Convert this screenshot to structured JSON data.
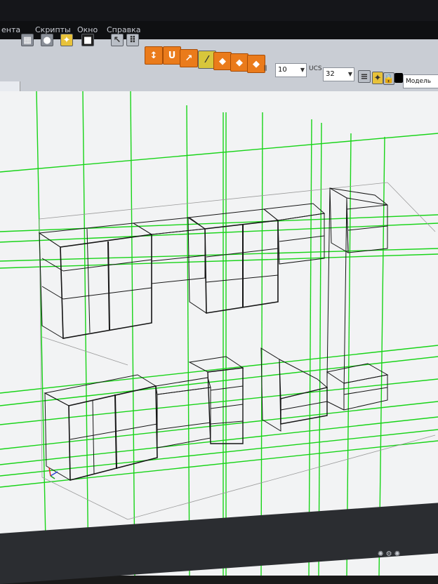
{
  "menubar": {
    "items": [
      "ента",
      "Скрипты",
      "Окно",
      "Справка"
    ]
  },
  "toolbar": {
    "layers_label": "10",
    "ucs_label": "UCS",
    "ucs_value": "32",
    "view_mode": "Модель"
  },
  "colors": {
    "guide_green": "#18d418",
    "frame_black": "#151515",
    "toolbar_bg": "#c9cdd4",
    "viewport_bg": "#f2f3f4"
  },
  "icons": {
    "toolbar_tools": [
      "cursor-icon",
      "dotted-grid-icon",
      "magnet-icon",
      "snap-icon",
      "measure-icon",
      "view-front-icon",
      "view-top-icon",
      "view-side-icon",
      "lock-icon",
      "lightbulb-icon",
      "color-swatch-icon"
    ]
  }
}
